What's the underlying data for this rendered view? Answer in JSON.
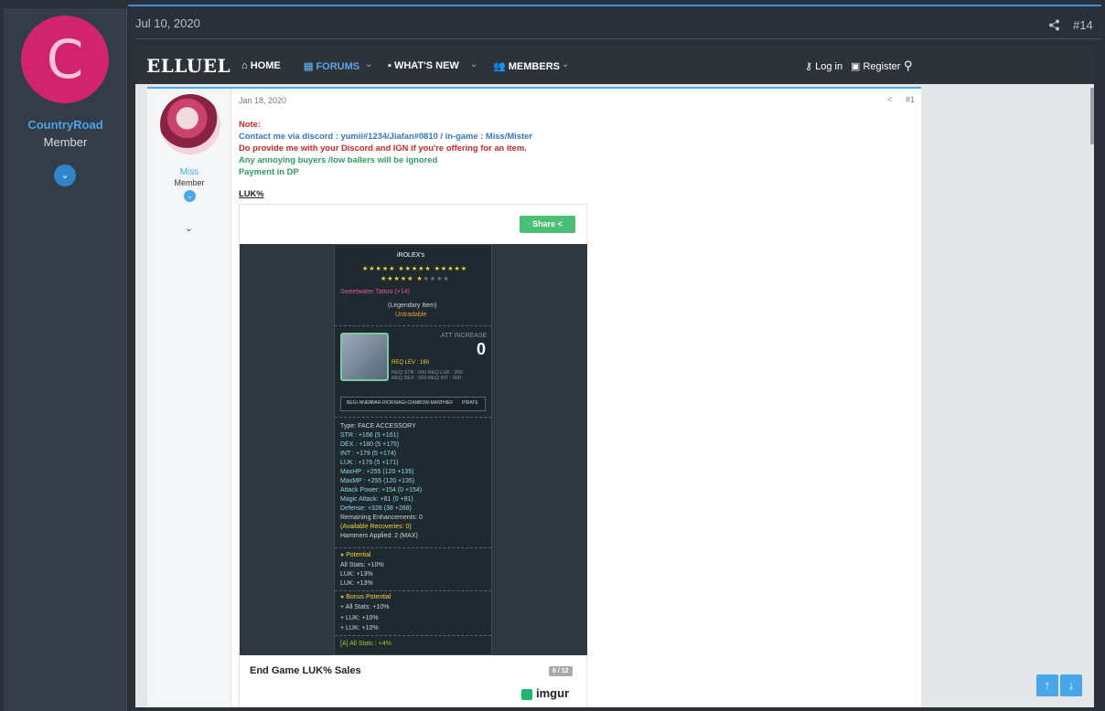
{
  "outer_post": {
    "date": "Jul 10, 2020",
    "number": "#14",
    "share_icon": "share-icon",
    "user": {
      "avatar_letter": "C",
      "avatar_color": "#d0246c",
      "name": "CountryRoad",
      "title": "Member"
    }
  },
  "embedded": {
    "nav": {
      "logo": "ELLUEL",
      "items": [
        {
          "label": "HOME",
          "icon": "home-icon"
        },
        {
          "label": "FORUMS",
          "icon": "forums-icon"
        },
        {
          "label": "WHAT'S NEW",
          "icon": "comment-icon"
        },
        {
          "label": "MEMBERS",
          "icon": "members-icon"
        }
      ],
      "login": "Log in",
      "register": "Register"
    },
    "post": {
      "date": "Jan 18, 2020",
      "number": "#1",
      "user": {
        "name": "Miss",
        "title": "Member"
      },
      "lines": [
        "Note:",
        "Contact me via discord : yumii#1234/Jiafan#0810 / in-game : Miss/Mister",
        "Do provide me with your Discord and IGN if you're offering for an item.",
        "Any annoying buyers /low ballers will be ignored",
        "Payment in DP"
      ],
      "heading": "LUK%",
      "imgur": {
        "share_label": "Share",
        "caption": "End Game LUK% Sales",
        "pages": "6 / 12",
        "logo": "imgur",
        "item": {
          "owner": "iROLEX's",
          "name": "Sweetwater Tattoo (+14)",
          "rarity": "(Legendary Item)",
          "trade": "Untradable",
          "att_label": "ATT INCREASE",
          "att_value": "0",
          "req_level": "REQ LEV : 160",
          "req_stats_1": "REQ STR : 000   REQ LUK : 000",
          "req_stats_2": "REQ DEX : 000   REQ INT : 000",
          "jobs": [
            "BEGI-NNER",
            "WAR-RIOR",
            "MAGI-CIAN",
            "BOW-MAN",
            "THIEF",
            "PIRATE"
          ],
          "stats": [
            "Type: FACE ACCESSORY",
            "STR : +166 (5 +161)",
            "DEX : +180 (5 +175)",
            "INT : +179 (5 +174)",
            "LUK : +176 (5 +171)",
            "MaxHP : +255 (120 +135)",
            "MaxMP : +255 (120 +135)",
            "Attack Power: +154 (0 +154)",
            "Magic Attack: +81 (0 +81)",
            "Defense: +326 (38 +288)",
            "Remaining Enhancements: 0",
            "(Available Recoveries: 0)",
            "Hammers Applied: 2 (MAX)"
          ],
          "potential_label": "Potential",
          "potential": [
            "All Stats: +10%",
            "LUK: +13%",
            "LUK: +13%"
          ],
          "bonus_label": "Bonus Potential",
          "bonus": [
            "+ All Stats: +10%",
            "+ LUK: +10%",
            "+ LUK: +10%"
          ],
          "extra": "[A]  All  Stats  :  +4%"
        }
      }
    }
  }
}
